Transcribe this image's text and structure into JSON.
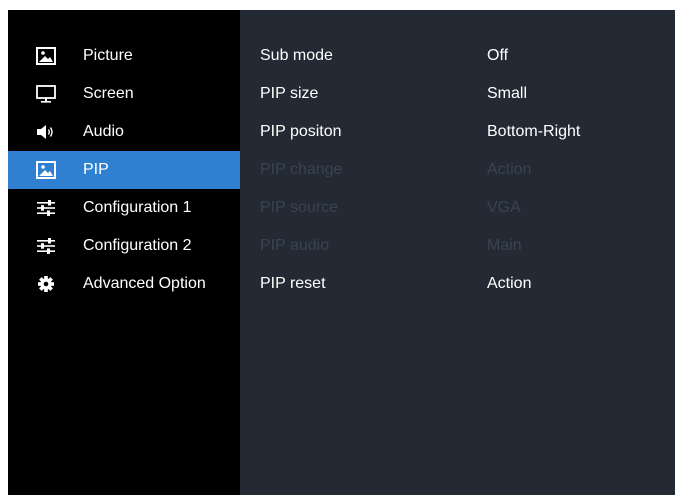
{
  "colors": {
    "sidebar_bg": "#000000",
    "content_bg": "#232a33",
    "active_bg": "#2f80d1",
    "text": "#ffffff",
    "disabled_text": "#3a4350"
  },
  "sidebar": {
    "items": [
      {
        "label": "Picture",
        "icon": "picture-icon",
        "active": false
      },
      {
        "label": "Screen",
        "icon": "monitor-icon",
        "active": false
      },
      {
        "label": "Audio",
        "icon": "speaker-icon",
        "active": false
      },
      {
        "label": "PIP",
        "icon": "picture-icon",
        "active": true
      },
      {
        "label": "Configuration 1",
        "icon": "sliders-icon",
        "active": false
      },
      {
        "label": "Configuration 2",
        "icon": "sliders-icon",
        "active": false
      },
      {
        "label": "Advanced Option",
        "icon": "gear-icon",
        "active": false
      }
    ]
  },
  "settings": {
    "rows": [
      {
        "name": "Sub mode",
        "value": "Off",
        "enabled": true
      },
      {
        "name": "PIP size",
        "value": "Small",
        "enabled": true
      },
      {
        "name": "PIP positon",
        "value": "Bottom-Right",
        "enabled": true
      },
      {
        "name": "PIP change",
        "value": "Action",
        "enabled": false
      },
      {
        "name": "PIP source",
        "value": "VGA",
        "enabled": false
      },
      {
        "name": "PIP audio",
        "value": "Main",
        "enabled": false
      },
      {
        "name": "PIP reset",
        "value": "Action",
        "enabled": true
      }
    ]
  }
}
